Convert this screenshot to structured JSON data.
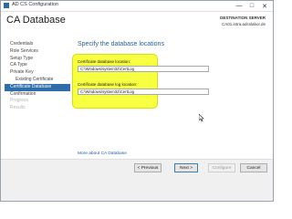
{
  "window": {
    "title": "AD CS Configuration",
    "controls": {
      "minimize": "—",
      "maximize": "□",
      "close": "✕"
    }
  },
  "header": {
    "page_title": "CA Database",
    "destination_label": "DESTINATION SERVER",
    "destination_value": "CA01.intra.adcslabor.de"
  },
  "nav": {
    "items": [
      {
        "label": "Credentials",
        "state": "normal"
      },
      {
        "label": "Role Services",
        "state": "normal"
      },
      {
        "label": "Setup Type",
        "state": "normal"
      },
      {
        "label": "CA Type",
        "state": "normal"
      },
      {
        "label": "Private Key",
        "state": "normal"
      },
      {
        "label": "Existing Certificate",
        "state": "sub"
      },
      {
        "label": "Certificate Database",
        "state": "active"
      },
      {
        "label": "Confirmation",
        "state": "normal"
      },
      {
        "label": "Progress",
        "state": "disabled"
      },
      {
        "label": "Results",
        "state": "disabled"
      }
    ]
  },
  "main": {
    "section_title": "Specify the database locations",
    "db_label": "Certificate database location:",
    "db_value": "C:\\Windows\\system32\\CertLog",
    "log_label": "Certificate database log location:",
    "log_value": "C:\\Windows\\system32\\CertLog",
    "more_link": "More about CA Database"
  },
  "footer": {
    "previous": "< Previous",
    "next": "Next >",
    "configure": "Configure",
    "cancel": "Cancel"
  },
  "colors": {
    "accent": "#2f6ea8",
    "highlight": "#f6ff40",
    "link": "#1f5fb2"
  }
}
